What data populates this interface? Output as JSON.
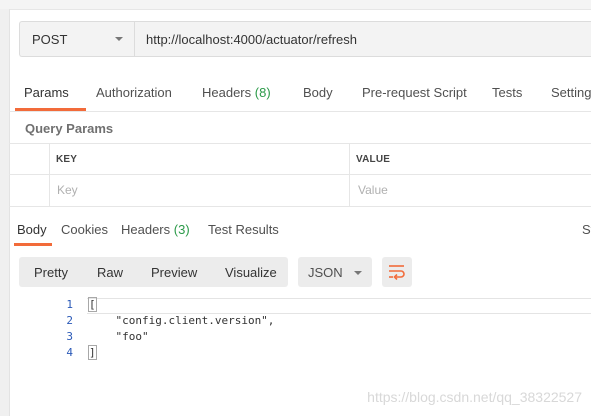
{
  "request": {
    "method": "POST",
    "url": "http://localhost:4000/actuator/refresh"
  },
  "request_tabs": [
    {
      "label": "Params",
      "count": ""
    },
    {
      "label": "Authorization",
      "count": ""
    },
    {
      "label": "Headers",
      "count": "(8)"
    },
    {
      "label": "Body",
      "count": ""
    },
    {
      "label": "Pre-request Script",
      "count": ""
    },
    {
      "label": "Tests",
      "count": ""
    },
    {
      "label": "Settings",
      "count": ""
    }
  ],
  "query_params": {
    "title": "Query Params",
    "col_key": "KEY",
    "col_value": "VALUE",
    "key_placeholder": "Key",
    "value_placeholder": "Value"
  },
  "response_tabs": [
    {
      "label": "Body",
      "count": ""
    },
    {
      "label": "Cookies",
      "count": ""
    },
    {
      "label": "Headers",
      "count": "(3)"
    },
    {
      "label": "Test Results",
      "count": ""
    }
  ],
  "response_status_partial": "St",
  "view_modes": [
    "Pretty",
    "Raw",
    "Preview",
    "Visualize"
  ],
  "format": "JSON",
  "code_lines": [
    {
      "num": "1",
      "text": "["
    },
    {
      "num": "2",
      "text": "    \"config.client.version\","
    },
    {
      "num": "3",
      "text": "    \"foo\""
    },
    {
      "num": "4",
      "text": "]"
    }
  ],
  "watermark": "https://blog.csdn.net/qq_38322527",
  "colors": {
    "accent": "#f26b3a",
    "count_green": "#2b9a49",
    "line_number": "#2a59b7"
  }
}
